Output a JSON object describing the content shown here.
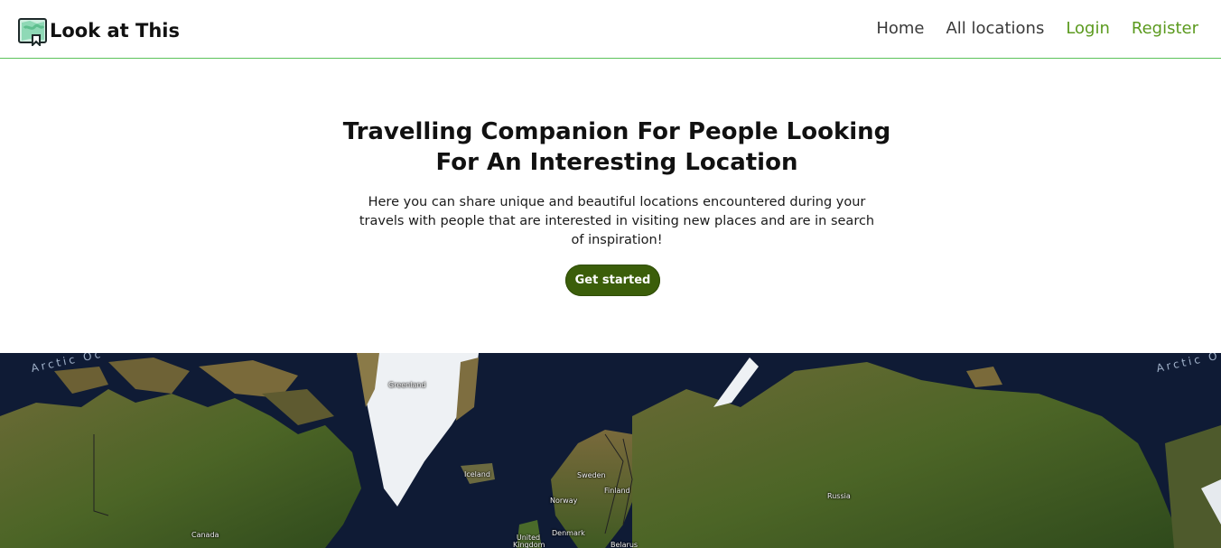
{
  "brand": {
    "name": "Look at This",
    "icon": "map-icon"
  },
  "nav": {
    "items": [
      {
        "label": "Home",
        "color": "#3a3a3a"
      },
      {
        "label": "All locations",
        "color": "#3a3a3a"
      },
      {
        "label": "Login",
        "color": "#5b9a1e"
      },
      {
        "label": "Register",
        "color": "#5b9a1e"
      }
    ],
    "border_color": "#5cc35a"
  },
  "hero": {
    "title_line1": "Travelling Companion For People Looking",
    "title_line2": "For An Interesting Location",
    "description": "Here you can share unique and beautiful locations encountered during your travels with people that are interested in visiting new places and are in search of inspiration!",
    "cta_label": "Get started",
    "cta_color": "#3b5e0a"
  },
  "map": {
    "ocean_left": "Arctic Oc",
    "ocean_right": "Arctic O",
    "labels": {
      "greenland": "Greenland",
      "iceland": "Iceland",
      "sweden": "Sweden",
      "norway": "Norway",
      "finland": "Finland",
      "russia": "Russia",
      "canada": "Canada",
      "denmark": "Denmark",
      "uk": "United Kingdom",
      "belarus": "Belarus"
    }
  }
}
